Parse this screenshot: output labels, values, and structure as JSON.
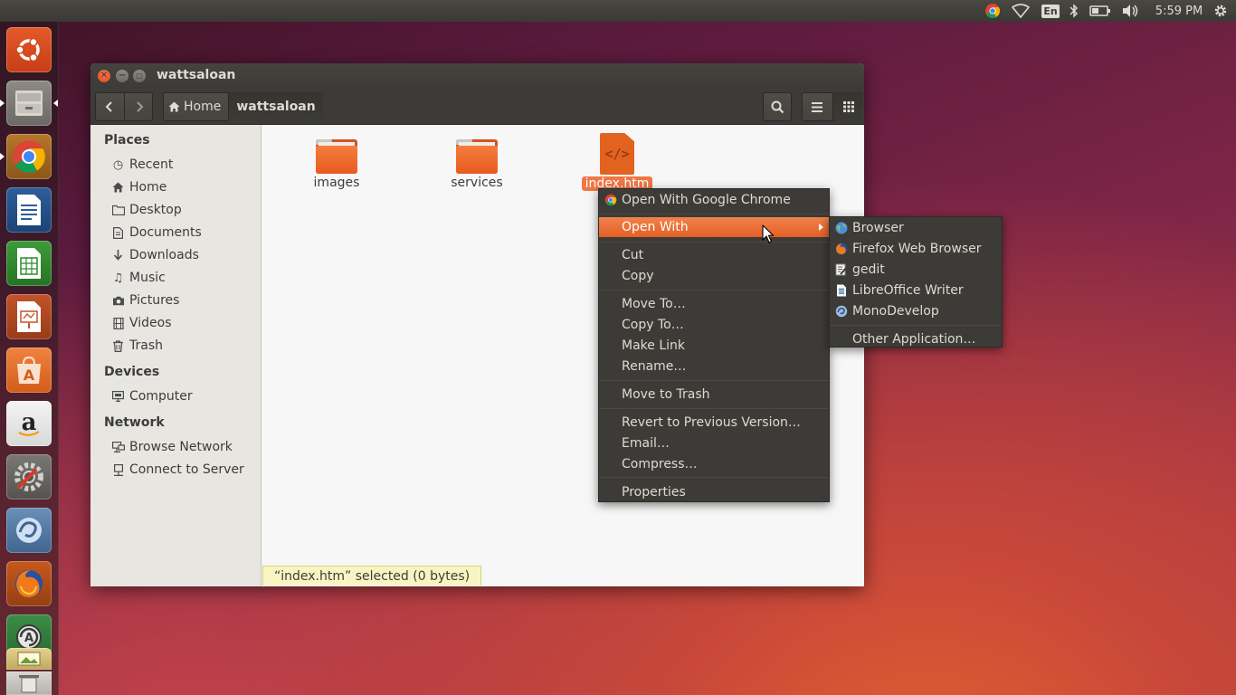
{
  "top_panel": {
    "keyboard_layout": "En",
    "clock": "5:59 PM"
  },
  "launcher": {
    "items": [
      "ubuntu-dash",
      "files",
      "google-chrome",
      "libreoffice-writer",
      "libreoffice-calc",
      "libreoffice-impress",
      "ubuntu-software-center",
      "amazon",
      "system-settings",
      "monodevelop",
      "firefox",
      "software-updater",
      "image-viewer",
      "trash"
    ]
  },
  "window": {
    "title": "wattsaloan",
    "breadcrumb": {
      "home_label": "Home",
      "current_label": "wattsaloan"
    }
  },
  "sidebar": {
    "places_heading": "Places",
    "places": [
      {
        "label": "Recent",
        "icon": "clock-icon"
      },
      {
        "label": "Home",
        "icon": "home-icon"
      },
      {
        "label": "Desktop",
        "icon": "folder-icon"
      },
      {
        "label": "Documents",
        "icon": "document-icon"
      },
      {
        "label": "Downloads",
        "icon": "download-icon"
      },
      {
        "label": "Music",
        "icon": "music-icon"
      },
      {
        "label": "Pictures",
        "icon": "camera-icon"
      },
      {
        "label": "Videos",
        "icon": "film-icon"
      },
      {
        "label": "Trash",
        "icon": "trash-icon"
      }
    ],
    "devices_heading": "Devices",
    "devices": [
      {
        "label": "Computer",
        "icon": "computer-icon"
      }
    ],
    "network_heading": "Network",
    "network": [
      {
        "label": "Browse Network",
        "icon": "network-icon"
      },
      {
        "label": "Connect to Server",
        "icon": "server-icon"
      }
    ]
  },
  "files": [
    {
      "name": "images",
      "type": "folder"
    },
    {
      "name": "services",
      "type": "folder"
    },
    {
      "name": "index.htm",
      "type": "html",
      "selected": true
    }
  ],
  "status": "“index.htm” selected  (0 bytes)",
  "context_menu": {
    "items": [
      {
        "label": "Open With Google Chrome",
        "icon": "chrome-icon"
      },
      {
        "label": "Open With",
        "highlighted": true,
        "submenu": true
      },
      {
        "label": "Cut"
      },
      {
        "label": "Copy"
      },
      {
        "label": "Move To…"
      },
      {
        "label": "Copy To…"
      },
      {
        "label": "Make Link"
      },
      {
        "label": "Rename…"
      },
      {
        "label": "Move to Trash"
      },
      {
        "label": "Revert to Previous Version…"
      },
      {
        "label": "Email…"
      },
      {
        "label": "Compress…"
      },
      {
        "label": "Properties"
      }
    ]
  },
  "submenu": {
    "items": [
      {
        "label": "Browser",
        "icon": "browser-icon"
      },
      {
        "label": "Firefox Web Browser",
        "icon": "firefox-icon"
      },
      {
        "label": "gedit",
        "icon": "gedit-icon"
      },
      {
        "label": "LibreOffice Writer",
        "icon": "writer-icon"
      },
      {
        "label": "MonoDevelop",
        "icon": "monodevelop-icon"
      },
      {
        "label": "Other Application…"
      }
    ]
  },
  "colors": {
    "accent": "#e95420",
    "panel": "#3c3b37",
    "menu_highlight": "#e95f24",
    "status_bg": "#f9f5c2"
  }
}
